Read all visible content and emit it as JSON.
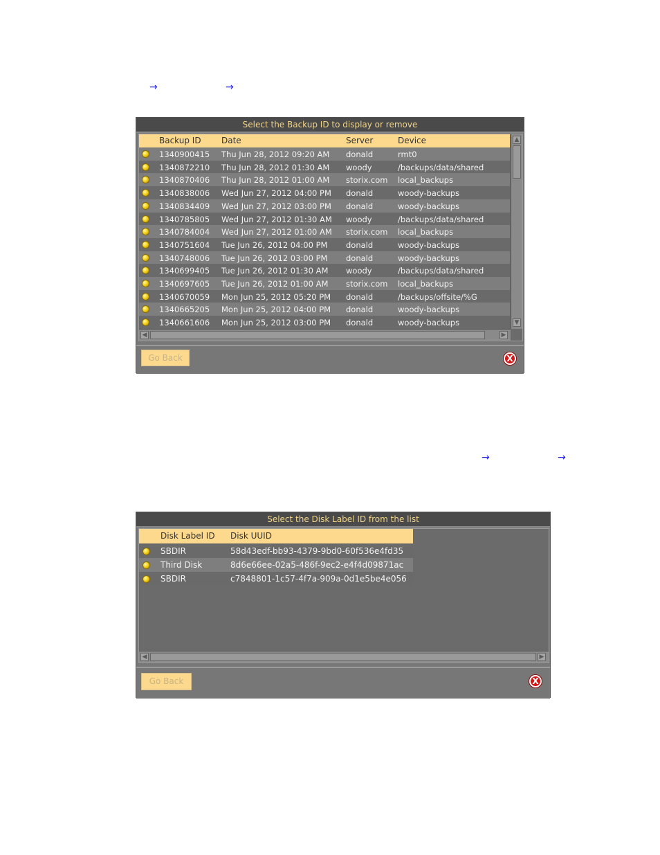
{
  "nav_arrows": {
    "glyph": "→"
  },
  "backup_dialog": {
    "title": "Select the Backup ID to display or remove",
    "columns": [
      "Backup ID",
      "Date",
      "Server",
      "Device"
    ],
    "rows": [
      [
        "1340900415",
        "Thu Jun 28, 2012 09:20 AM",
        "donald",
        "rmt0"
      ],
      [
        "1340872210",
        "Thu Jun 28, 2012 01:30 AM",
        "woody",
        "/backups/data/shared"
      ],
      [
        "1340870406",
        "Thu Jun 28, 2012 01:00 AM",
        "storix.com",
        "local_backups"
      ],
      [
        "1340838006",
        "Wed Jun 27, 2012 04:00 PM",
        "donald",
        "woody-backups"
      ],
      [
        "1340834409",
        "Wed Jun 27, 2012 03:00 PM",
        "donald",
        "woody-backups"
      ],
      [
        "1340785805",
        "Wed Jun 27, 2012 01:30 AM",
        "woody",
        "/backups/data/shared"
      ],
      [
        "1340784004",
        "Wed Jun 27, 2012 01:00 AM",
        "storix.com",
        "local_backups"
      ],
      [
        "1340751604",
        "Tue Jun 26, 2012 04:00 PM",
        "donald",
        "woody-backups"
      ],
      [
        "1340748006",
        "Tue Jun 26, 2012 03:00 PM",
        "donald",
        "woody-backups"
      ],
      [
        "1340699405",
        "Tue Jun 26, 2012 01:30 AM",
        "woody",
        "/backups/data/shared"
      ],
      [
        "1340697605",
        "Tue Jun 26, 2012 01:00 AM",
        "storix.com",
        "local_backups"
      ],
      [
        "1340670059",
        "Mon Jun 25, 2012 05:20 PM",
        "donald",
        "/backups/offsite/%G"
      ],
      [
        "1340665205",
        "Mon Jun 25, 2012 04:00 PM",
        "donald",
        "woody-backups"
      ],
      [
        "1340661606",
        "Mon Jun 25, 2012 03:00 PM",
        "donald",
        "woody-backups"
      ]
    ],
    "go_back": "Go Back",
    "close_glyph": "X"
  },
  "disk_dialog": {
    "title": "Select the Disk Label ID from the list",
    "columns": [
      "Disk Label ID",
      "Disk UUID"
    ],
    "rows": [
      [
        "SBDIR",
        "58d43edf-bb93-4379-9bd0-60f536e4fd35"
      ],
      [
        "Third Disk",
        "8d6e66ee-02a5-486f-9ec2-e4f4d09871ac"
      ],
      [
        "SBDIR",
        "c7848801-1c57-4f7a-909a-0d1e5be4e056"
      ]
    ],
    "go_back": "Go Back",
    "close_glyph": "X"
  },
  "colors": {
    "header_bg": "#fcd98c",
    "title_text": "#f2d484",
    "close_red": "#d61515",
    "arrow_blue": "#1a1ae6"
  }
}
